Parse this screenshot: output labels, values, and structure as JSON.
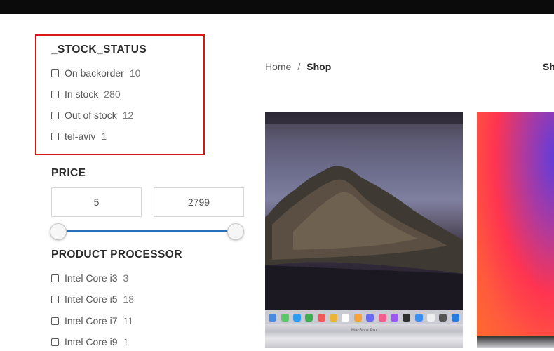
{
  "stock_status": {
    "title": "_STOCK_STATUS",
    "options": [
      {
        "label": "On backorder",
        "count": "10"
      },
      {
        "label": "In stock",
        "count": "280"
      },
      {
        "label": "Out of stock",
        "count": "12"
      },
      {
        "label": "tel-aviv",
        "count": "1"
      }
    ],
    "highlight_color": "#d81818"
  },
  "price": {
    "title": "PRICE",
    "min_value": "5",
    "max_value": "2799",
    "slider_min_fraction": 0.0,
    "slider_max_fraction": 1.0,
    "slider_color": "#2a6fb8"
  },
  "processor": {
    "title": "PRODUCT PROCESSOR",
    "options": [
      {
        "label": "Intel Core i3",
        "count": "3"
      },
      {
        "label": "Intel Core i5",
        "count": "18"
      },
      {
        "label": "Intel Core i7",
        "count": "11"
      },
      {
        "label": "Intel Core i9",
        "count": "1"
      }
    ]
  },
  "breadcrumb": {
    "home": "Home",
    "separator": "/",
    "current": "Shop"
  },
  "sort_label_cut": "Sh",
  "products": [
    {
      "image": "macbook-pro-catalina-wallpaper",
      "base_label": "MacBook Pro"
    },
    {
      "image": "macbook-big-sur-wallpaper"
    }
  ]
}
